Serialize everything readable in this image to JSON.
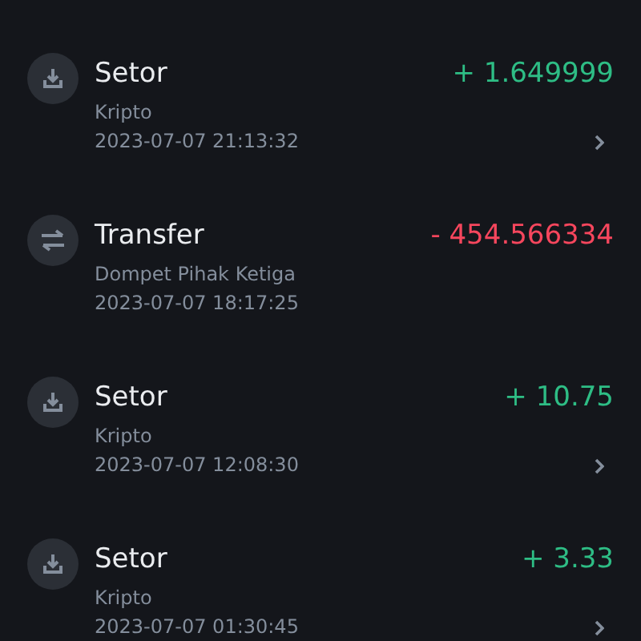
{
  "transactions": [
    {
      "kind": "deposit",
      "title": "Setor",
      "subtitle": "Kripto",
      "datetime": "2023-07-07 21:13:32",
      "amount": "+ 1.649999",
      "color": "#2ebd85",
      "chevron": true
    },
    {
      "kind": "transfer",
      "title": "Transfer",
      "subtitle": "Dompet Pihak Ketiga",
      "datetime": "2023-07-07 18:17:25",
      "amount": "- 454.566334",
      "color": "#f6465d",
      "chevron": false
    },
    {
      "kind": "deposit",
      "title": "Setor",
      "subtitle": "Kripto",
      "datetime": "2023-07-07 12:08:30",
      "amount": "+ 10.75",
      "color": "#2ebd85",
      "chevron": true
    },
    {
      "kind": "deposit",
      "title": "Setor",
      "subtitle": "Kripto",
      "datetime": "2023-07-07 01:30:45",
      "amount": "+ 3.33",
      "color": "#2ebd85",
      "chevron": true
    }
  ]
}
